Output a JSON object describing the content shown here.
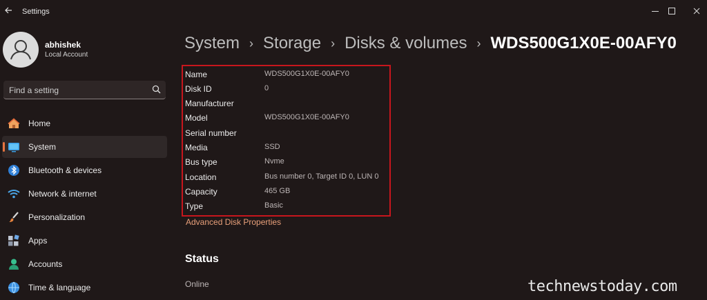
{
  "window": {
    "title": "Settings"
  },
  "user": {
    "name": "abhishek",
    "account_type": "Local Account"
  },
  "search": {
    "placeholder": "Find a setting",
    "value": ""
  },
  "accent_color": "#e8743f",
  "nav": {
    "items": [
      {
        "label": "Home",
        "icon": "home-icon",
        "active": false
      },
      {
        "label": "System",
        "icon": "system-icon",
        "active": true
      },
      {
        "label": "Bluetooth & devices",
        "icon": "bluetooth-icon",
        "active": false
      },
      {
        "label": "Network & internet",
        "icon": "wifi-icon",
        "active": false
      },
      {
        "label": "Personalization",
        "icon": "brush-icon",
        "active": false
      },
      {
        "label": "Apps",
        "icon": "apps-icon",
        "active": false
      },
      {
        "label": "Accounts",
        "icon": "accounts-icon",
        "active": false
      },
      {
        "label": "Time & language",
        "icon": "time-language-icon",
        "active": false
      }
    ]
  },
  "breadcrumb": [
    "System",
    "Storage",
    "Disks & volumes",
    "WDS500G1X0E-00AFY0"
  ],
  "properties": [
    {
      "key": "Name",
      "value": "WDS500G1X0E-00AFY0"
    },
    {
      "key": "Disk ID",
      "value": "0"
    },
    {
      "key": "Manufacturer",
      "value": ""
    },
    {
      "key": "Model",
      "value": "WDS500G1X0E-00AFY0"
    },
    {
      "key": "Serial number",
      "value": ""
    },
    {
      "key": "Media",
      "value": "SSD"
    },
    {
      "key": "Bus type",
      "value": "Nvme"
    },
    {
      "key": "Location",
      "value": "Bus number 0, Target ID 0, LUN 0"
    },
    {
      "key": "Capacity",
      "value": "465 GB"
    },
    {
      "key": "Type",
      "value": "Basic"
    }
  ],
  "advanced_link": "Advanced Disk Properties",
  "status": {
    "title": "Status",
    "value": "Online"
  },
  "watermark": "technewstoday.com"
}
